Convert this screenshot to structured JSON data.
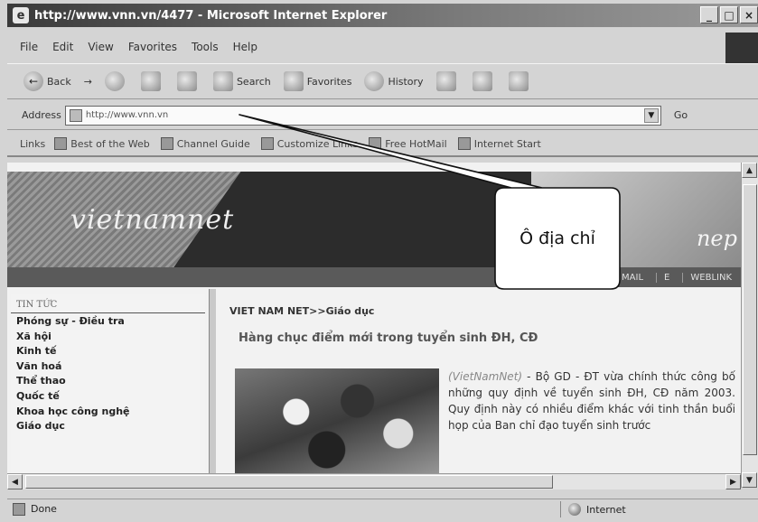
{
  "window": {
    "title": "http://www.vnn.vn/4477 - Microsoft Internet Explorer",
    "min_glyph": "_",
    "max_glyph": "□",
    "close_glyph": "×"
  },
  "menu": [
    "File",
    "Edit",
    "View",
    "Favorites",
    "Tools",
    "Help"
  ],
  "toolbar": {
    "back": "Back",
    "forward_glyph": "→",
    "search": "Search",
    "favorites": "Favorites",
    "history": "History"
  },
  "address": {
    "label": "Address",
    "value": "http://www.vnn.vn",
    "go": "Go"
  },
  "links": {
    "label": "Links",
    "items": [
      "Best of the Web",
      "Channel Guide",
      "Customize Links",
      "Free HotMail",
      "Internet Start"
    ]
  },
  "banner": {
    "logo": "vietnamnet",
    "right_logo": "nep"
  },
  "navstrip": [
    "CHECK MAIL",
    "E",
    "WEBLINK"
  ],
  "leftnav": {
    "header": "TIN TỨC",
    "items": [
      "Phóng sự - Điều tra",
      "Xã hội",
      "Kinh tế",
      "Văn hoá",
      "Thể thao",
      "Quốc tế",
      "Khoa học công nghệ",
      "Giáo dục"
    ]
  },
  "article": {
    "breadcrumb": "VIET NAM NET>>Giáo dục",
    "headline": "Hàng chục điểm mới trong tuyển sinh ĐH, CĐ",
    "source": "(VietNamNet)",
    "body": " - Bộ GD - ĐT vừa chính thức công bố những quy định về tuyển sinh ĐH, CĐ năm 2003. Quy định này có nhiều điểm khác với tinh thần buổi họp của Ban chỉ đạo tuyển sinh trước"
  },
  "status": {
    "text": "Done",
    "zone": "Internet"
  },
  "callout": {
    "label": "Ô địa chỉ"
  },
  "colors": {
    "titlebar_dark": "#3a3a3a",
    "chrome": "#d4d4d4",
    "content_bg": "#f2f2f2"
  },
  "icons": [
    "ie-logo-icon",
    "back-arrow-icon",
    "forward-arrow-icon",
    "stop-icon",
    "refresh-icon",
    "home-icon",
    "search-icon",
    "favorites-icon",
    "history-icon",
    "mail-icon",
    "print-icon",
    "edit-icon",
    "page-icon",
    "globe-icon"
  ]
}
